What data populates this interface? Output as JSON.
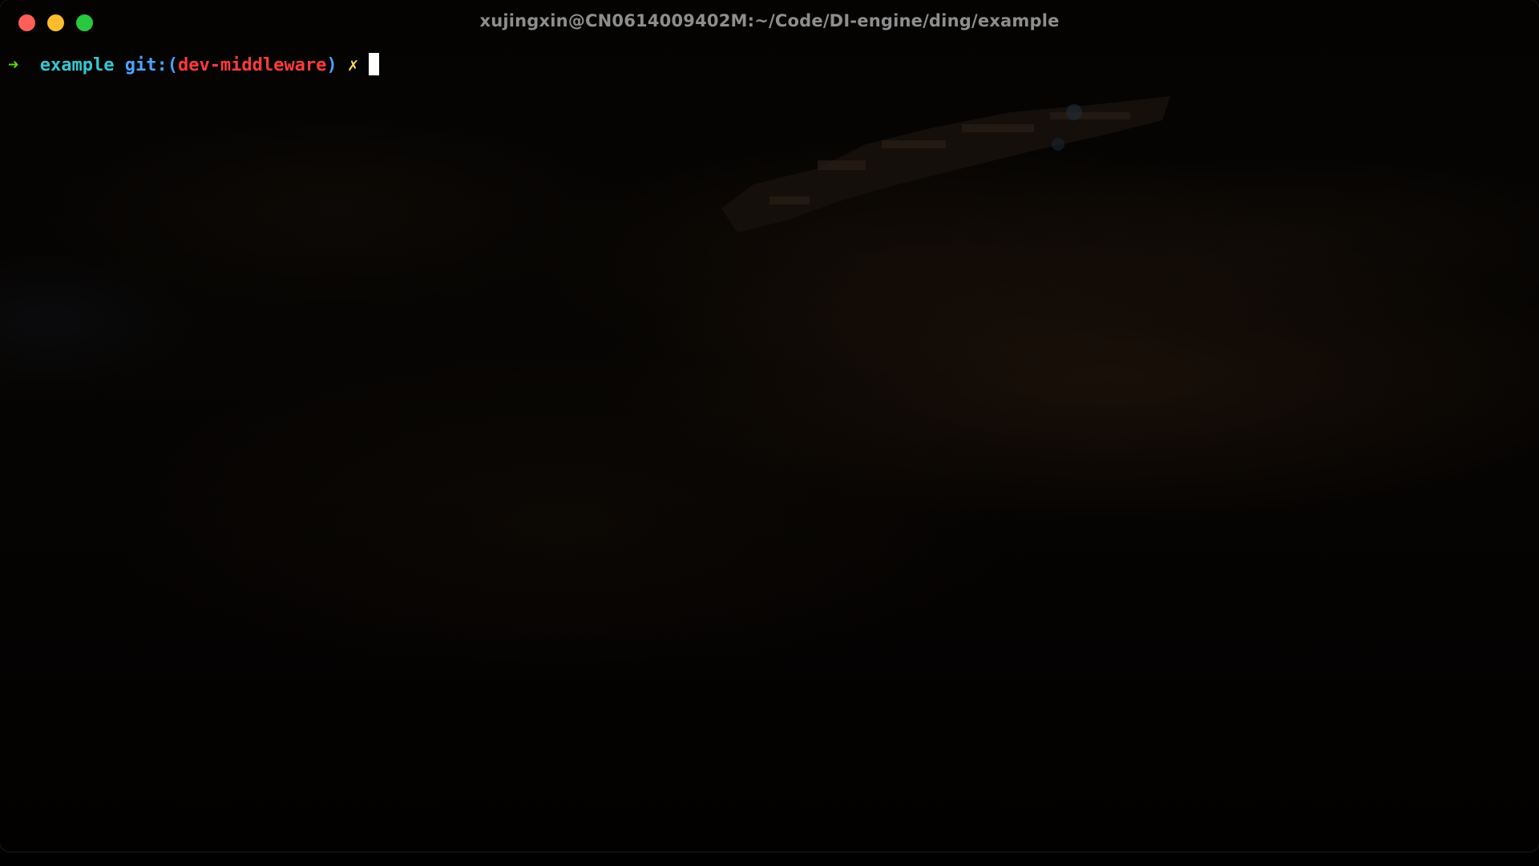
{
  "window": {
    "title": "xujingxin@CN0614009402M:~/Code/DI-engine/ding/example"
  },
  "traffic_lights": {
    "close_color": "#fe5f57",
    "minimize_color": "#febc2e",
    "maximize_color": "#28c840"
  },
  "prompt": {
    "arrow": "➜",
    "directory": "example",
    "git_label": "git:(",
    "branch": "dev-middleware",
    "git_close": ")",
    "dirty_marker": "✗",
    "colors": {
      "arrow": "#5fd700",
      "directory": "#36c6d3",
      "git": "#4aa3ff",
      "branch": "#ff3b3b",
      "dirty": "#ffd75f"
    }
  }
}
